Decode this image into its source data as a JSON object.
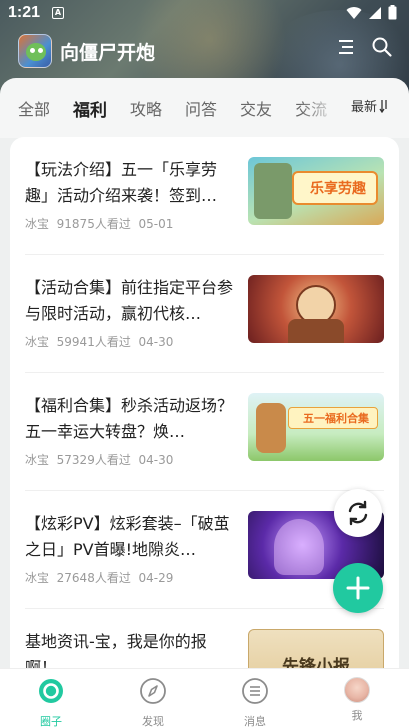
{
  "status_bar": {
    "time": "1:21",
    "notif_badge": "A"
  },
  "app": {
    "title": "向僵尸开炮"
  },
  "icons": {
    "menu": "menu-lines-icon",
    "search": "search-icon",
    "sort": "sort-arrows-icon",
    "refresh": "refresh-icon",
    "add": "plus-icon"
  },
  "tabs": [
    {
      "label": "全部"
    },
    {
      "label": "福利",
      "active": true
    },
    {
      "label": "攻略"
    },
    {
      "label": "问答"
    },
    {
      "label": "交友"
    },
    {
      "label": "交流"
    }
  ],
  "sort": {
    "label": "最新"
  },
  "posts": [
    {
      "title": "【玩法介绍】五一「乐享劳趣」活动介绍来袭！签到…",
      "author": "冰宝",
      "views": "91875人看过",
      "date": "05-01",
      "thumb_text": "乐享劳趣"
    },
    {
      "title": "【活动合集】前往指定平台参与限时活动，赢初代核…",
      "author": "冰宝",
      "views": "59941人看过",
      "date": "04-30",
      "thumb_text": ""
    },
    {
      "title": "【福利合集】秒杀活动返场？五一幸运大转盘？焕…",
      "author": "冰宝",
      "views": "57329人看过",
      "date": "04-30",
      "thumb_text": "五一福利合集"
    },
    {
      "title": "【炫彩PV】炫彩套装–「破茧之日」PV首曝!地隙炎…",
      "author": "冰宝",
      "views": "27648人看过",
      "date": "04-29",
      "thumb_text": ""
    },
    {
      "title": "基地资讯-宝，我是你的报啊！",
      "author": "",
      "views": "",
      "date": "",
      "thumb_text": "先锋小报"
    }
  ],
  "bottom_nav": [
    {
      "label": "圈子",
      "icon": "circle-ring-icon",
      "active": true
    },
    {
      "label": "发现",
      "icon": "compass-icon"
    },
    {
      "label": "消息",
      "icon": "message-list-icon"
    },
    {
      "label": "我",
      "icon": "avatar-icon"
    }
  ],
  "colors": {
    "accent": "#21c9a0",
    "tab_underline": "#2fd5b4"
  }
}
